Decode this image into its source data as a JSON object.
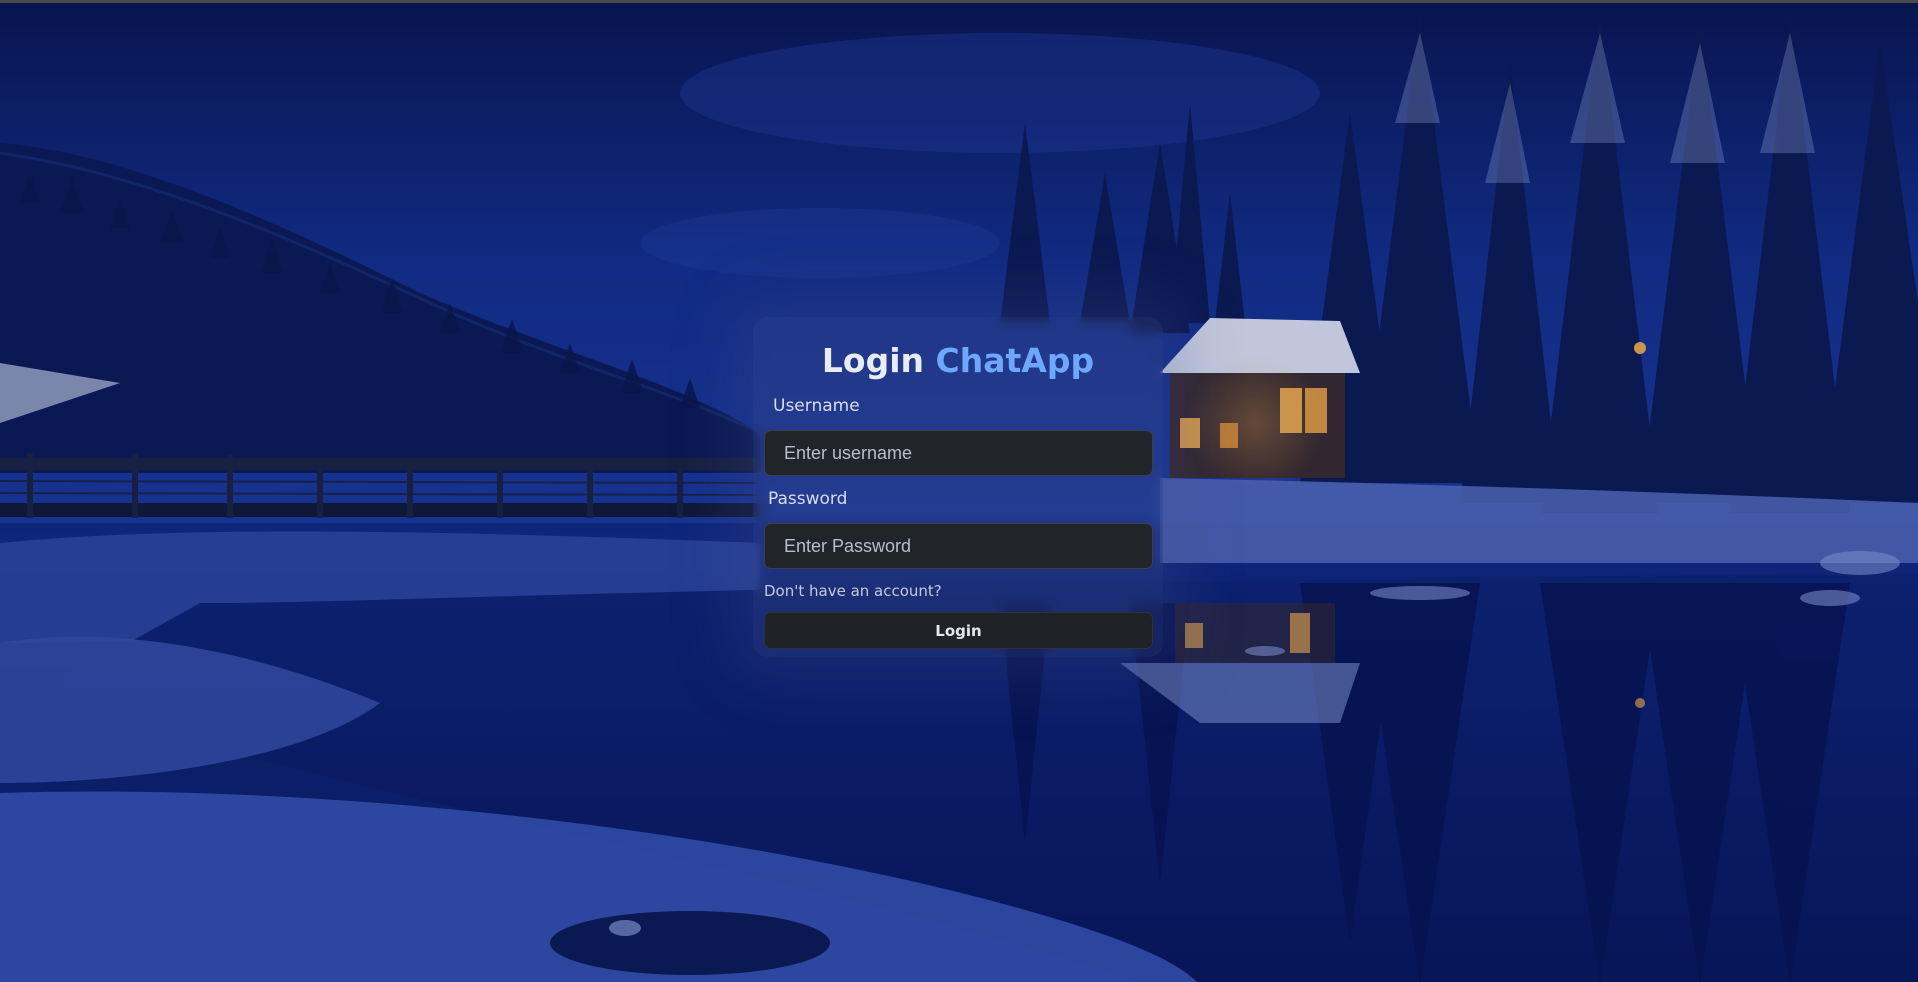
{
  "app": {
    "title_prefix": "Login",
    "title_brand": "ChatApp"
  },
  "form": {
    "username_label": "Username",
    "username_placeholder": "Enter username",
    "username_value": "",
    "password_label": "Password",
    "password_placeholder": "Enter Password",
    "password_value": "",
    "signup_link": "Don't have an account?",
    "submit_label": "Login"
  },
  "colors": {
    "brand_accent": "#6ea8fe",
    "input_bg": "#212529",
    "button_bg": "#1f2327",
    "background_night_blue": "#0f2a86"
  },
  "background": {
    "scene": "snowy-night-lake-cabin-icon"
  }
}
